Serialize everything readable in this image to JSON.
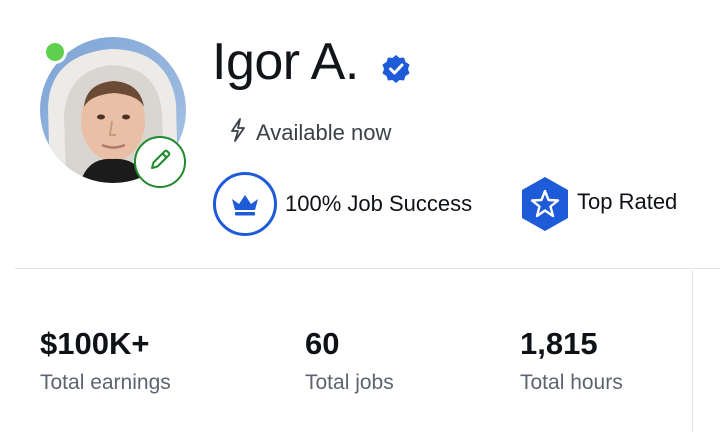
{
  "profile": {
    "name": "Igor A.",
    "availability": "Available now",
    "badges": {
      "job_success": "100% Job Success",
      "top_rated": "Top Rated"
    }
  },
  "stats": [
    {
      "value": "$100K+",
      "label": "Total earnings"
    },
    {
      "value": "60",
      "label": "Total jobs"
    },
    {
      "value": "1,815",
      "label": "Total hours"
    }
  ],
  "colors": {
    "online": "#5fcf4e",
    "edit_border": "#1f8a2e",
    "verified": "#1e5bd8",
    "badge_blue": "#1e5bd8"
  },
  "icons": {
    "online": "online-status-dot",
    "edit": "pencil-icon",
    "verified": "verified-check-icon",
    "availability": "lightning-bolt-icon",
    "job_success": "crown-icon",
    "top_rated": "star-icon"
  }
}
